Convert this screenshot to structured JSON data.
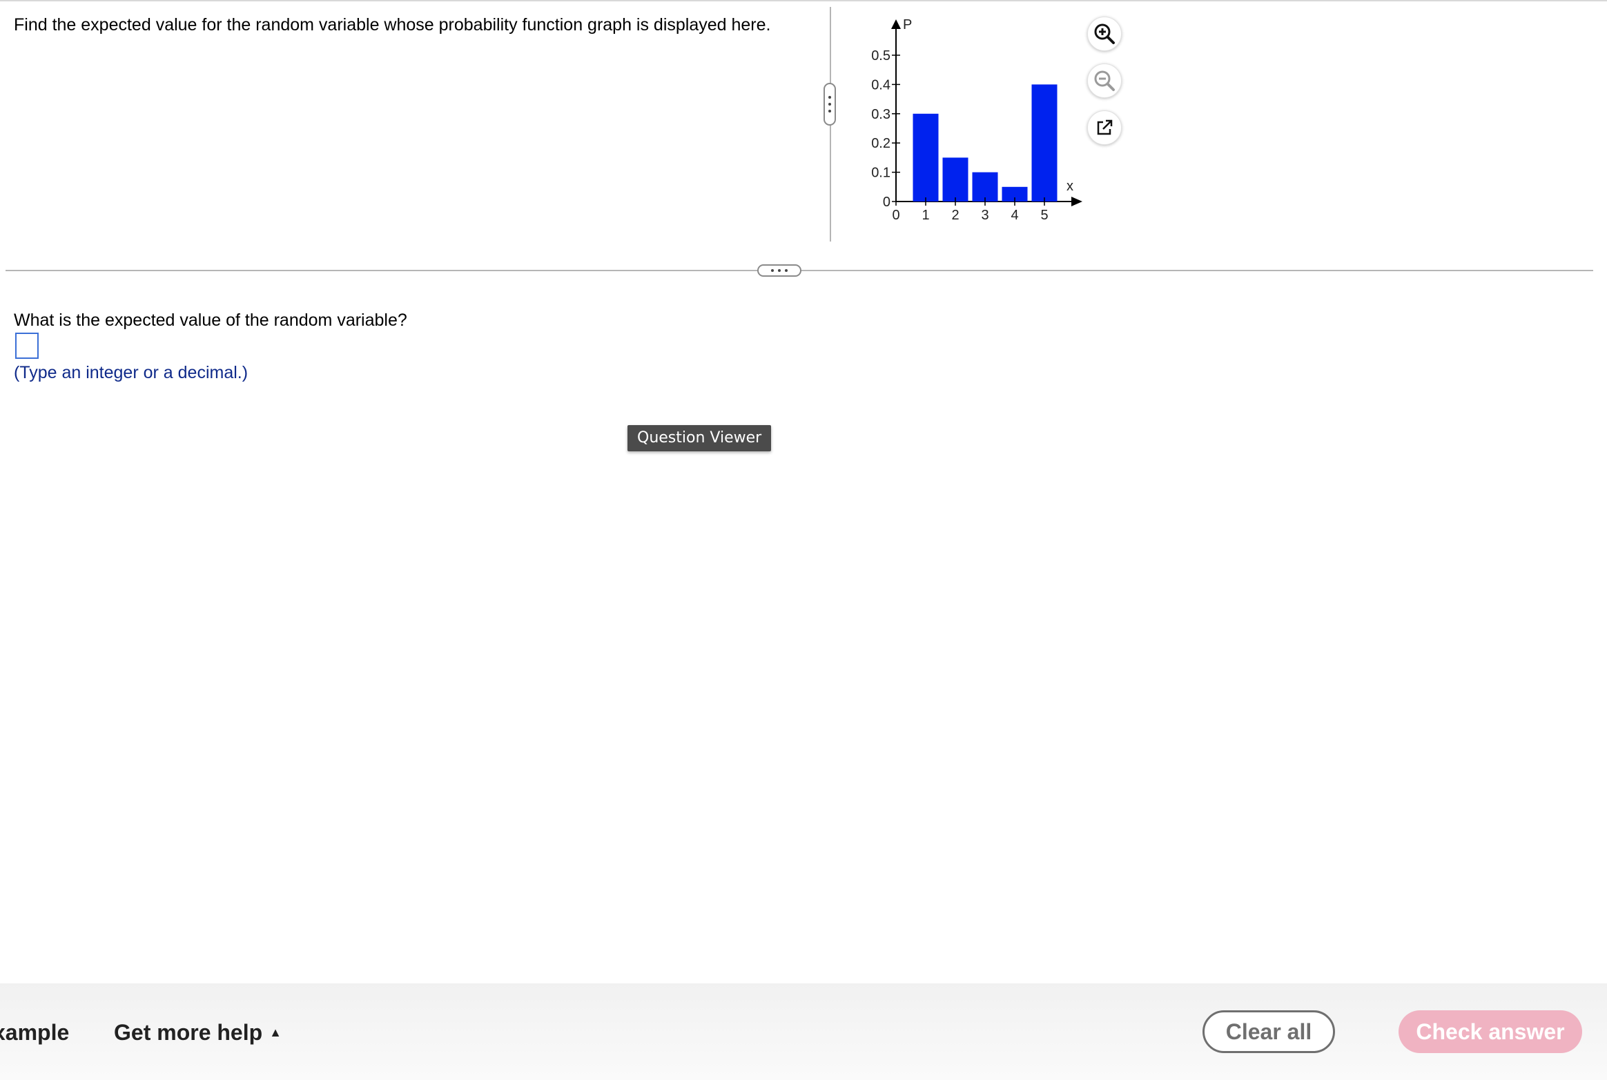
{
  "question": {
    "text": "Find the expected value for the random variable whose probability function graph is displayed here."
  },
  "chart_data": {
    "type": "bar",
    "x": [
      1,
      2,
      3,
      4,
      5
    ],
    "values": [
      0.3,
      0.15,
      0.1,
      0.05,
      0.4
    ],
    "ylabel": "P",
    "xlabel": "x",
    "xlim": [
      0,
      6
    ],
    "ylim": [
      0,
      0.55
    ],
    "x_ticks": [
      "0",
      "1",
      "2",
      "3",
      "4",
      "5"
    ],
    "y_ticks": [
      "0",
      "0.1",
      "0.2",
      "0.3",
      "0.4",
      "0.5"
    ],
    "bar_color": "#0022ee",
    "grid": false
  },
  "tools": {
    "zoom_in": "zoom-in-icon",
    "zoom_out": "zoom-out-icon",
    "popout": "external-link-icon"
  },
  "answer": {
    "prompt": "What is the expected value of the random variable?",
    "value": "",
    "hint": "(Type an integer or a decimal.)"
  },
  "question_viewer": {
    "label": "Question Viewer"
  },
  "footer": {
    "example_label": "xample",
    "help_label": "Get more help",
    "clear_label": "Clear all",
    "check_label": "Check answer"
  },
  "colors": {
    "accent_blue": "#3b6fd6",
    "hint_blue": "#0f2a8a",
    "check_disabled": "#f0b3c2"
  }
}
